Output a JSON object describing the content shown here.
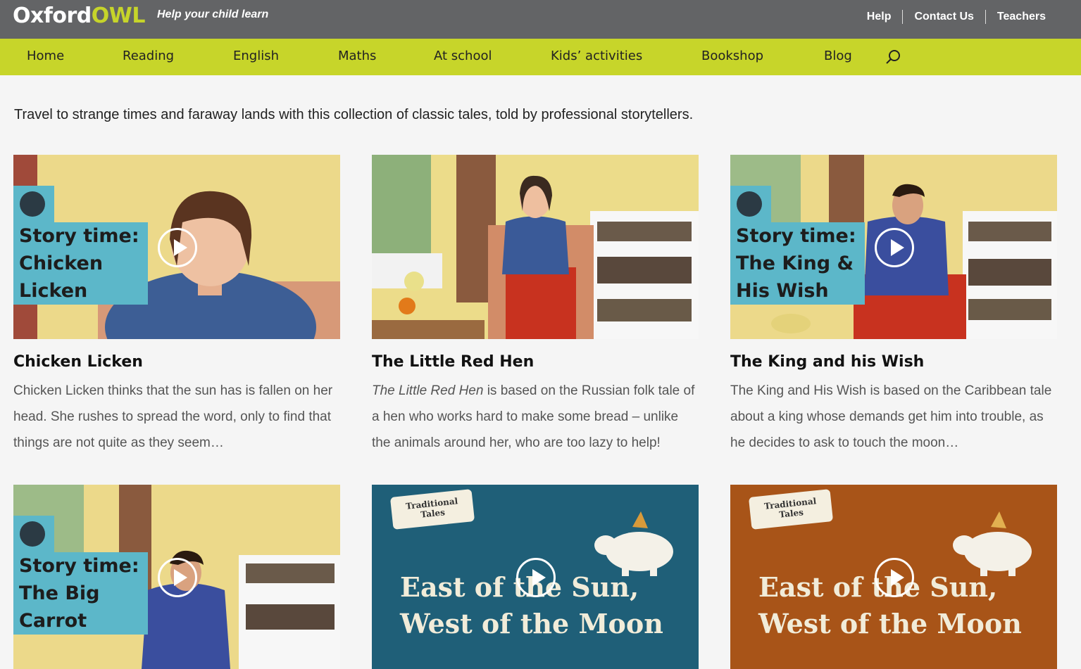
{
  "brand": {
    "logo_main": "Oxford",
    "logo_owl": "OWL",
    "tagline": "Help your child learn"
  },
  "top_links": [
    "Help",
    "Contact Us",
    "Teachers"
  ],
  "nav": [
    "Home",
    "Reading",
    "English",
    "Maths",
    "At school",
    "Kids’ activities",
    "Bookshop",
    "Blog"
  ],
  "section": {
    "title": "Traditional Tales",
    "intro": "Travel to strange times and faraway lands with this collection of classic tales, told by professional storytellers."
  },
  "cards": [
    {
      "title": "Chicken Licken",
      "label": "Story time:\nChicken\nLicken",
      "desc_em": "",
      "desc": "Chicken Licken thinks that the sun has is fallen on her head. She rushes to spread the word, only to find that things are not quite as they seem…"
    },
    {
      "title": "The Little Red Hen",
      "label": "",
      "desc_em": "The Little Red Hen",
      "desc": " is based on the Russian folk tale of a hen who works hard to make some bread – unlike the animals around her, who are too lazy to help!"
    },
    {
      "title": "The King and his Wish",
      "label": "Story time:\nThe King &\nHis Wish",
      "desc_em": "",
      "desc": "The King and His Wish is based on the Caribbean tale about a king whose demands get him into trouble, as he decides to ask to touch the moon…"
    },
    {
      "title": "",
      "label": "Story time:\nThe Big\nCarrot",
      "desc_em": "",
      "desc": ""
    },
    {
      "title": "",
      "tag": "Traditional\nTales",
      "video_title_1": "East of the Sun,",
      "video_title_2": "West of the Moon",
      "desc_em": "",
      "desc": ""
    },
    {
      "title": "",
      "tag": "Traditional\nTales",
      "video_title_1": "East of the Sun,",
      "video_title_2": "West of the Moon",
      "desc_em": "",
      "desc": ""
    }
  ],
  "colors": {
    "top_bar": "#636466",
    "nav_bar": "#c7d52a",
    "story_label": "#5cb7c9",
    "tale_blue": "#1f5f78",
    "tale_orange": "#a85418"
  }
}
